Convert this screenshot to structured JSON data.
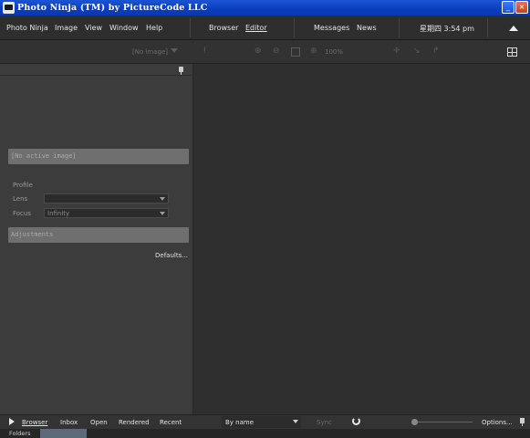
{
  "window": {
    "title": "Photo Ninja (TM) by PictureCode LLC",
    "min": "_",
    "close": "×"
  },
  "menu": {
    "items": [
      "Photo Ninja",
      "Image",
      "View",
      "Window",
      "Help"
    ],
    "browser": "Browser",
    "editor": "Editor",
    "messages": "Messages",
    "news": "News",
    "clock": "星期四 3:54 pm"
  },
  "toolbar": {
    "image_select": "[No image]",
    "zoom": "100%"
  },
  "panel": {
    "no_active_image": "[No active image]",
    "profile_label": "Profile",
    "lens_label": "Lens",
    "lens_value": "",
    "focus_label": "Focus",
    "focus_value": "Infinity",
    "adjustments": "Adjustments",
    "defaults": "Defaults..."
  },
  "bottom": {
    "browser": "Browser",
    "inbox": "Inbox",
    "open": "Open",
    "rendered": "Rendered",
    "recent": "Recent",
    "sort": "By name",
    "sync": "Sync",
    "options": "Options..."
  },
  "status": {
    "folders": "Folders"
  }
}
